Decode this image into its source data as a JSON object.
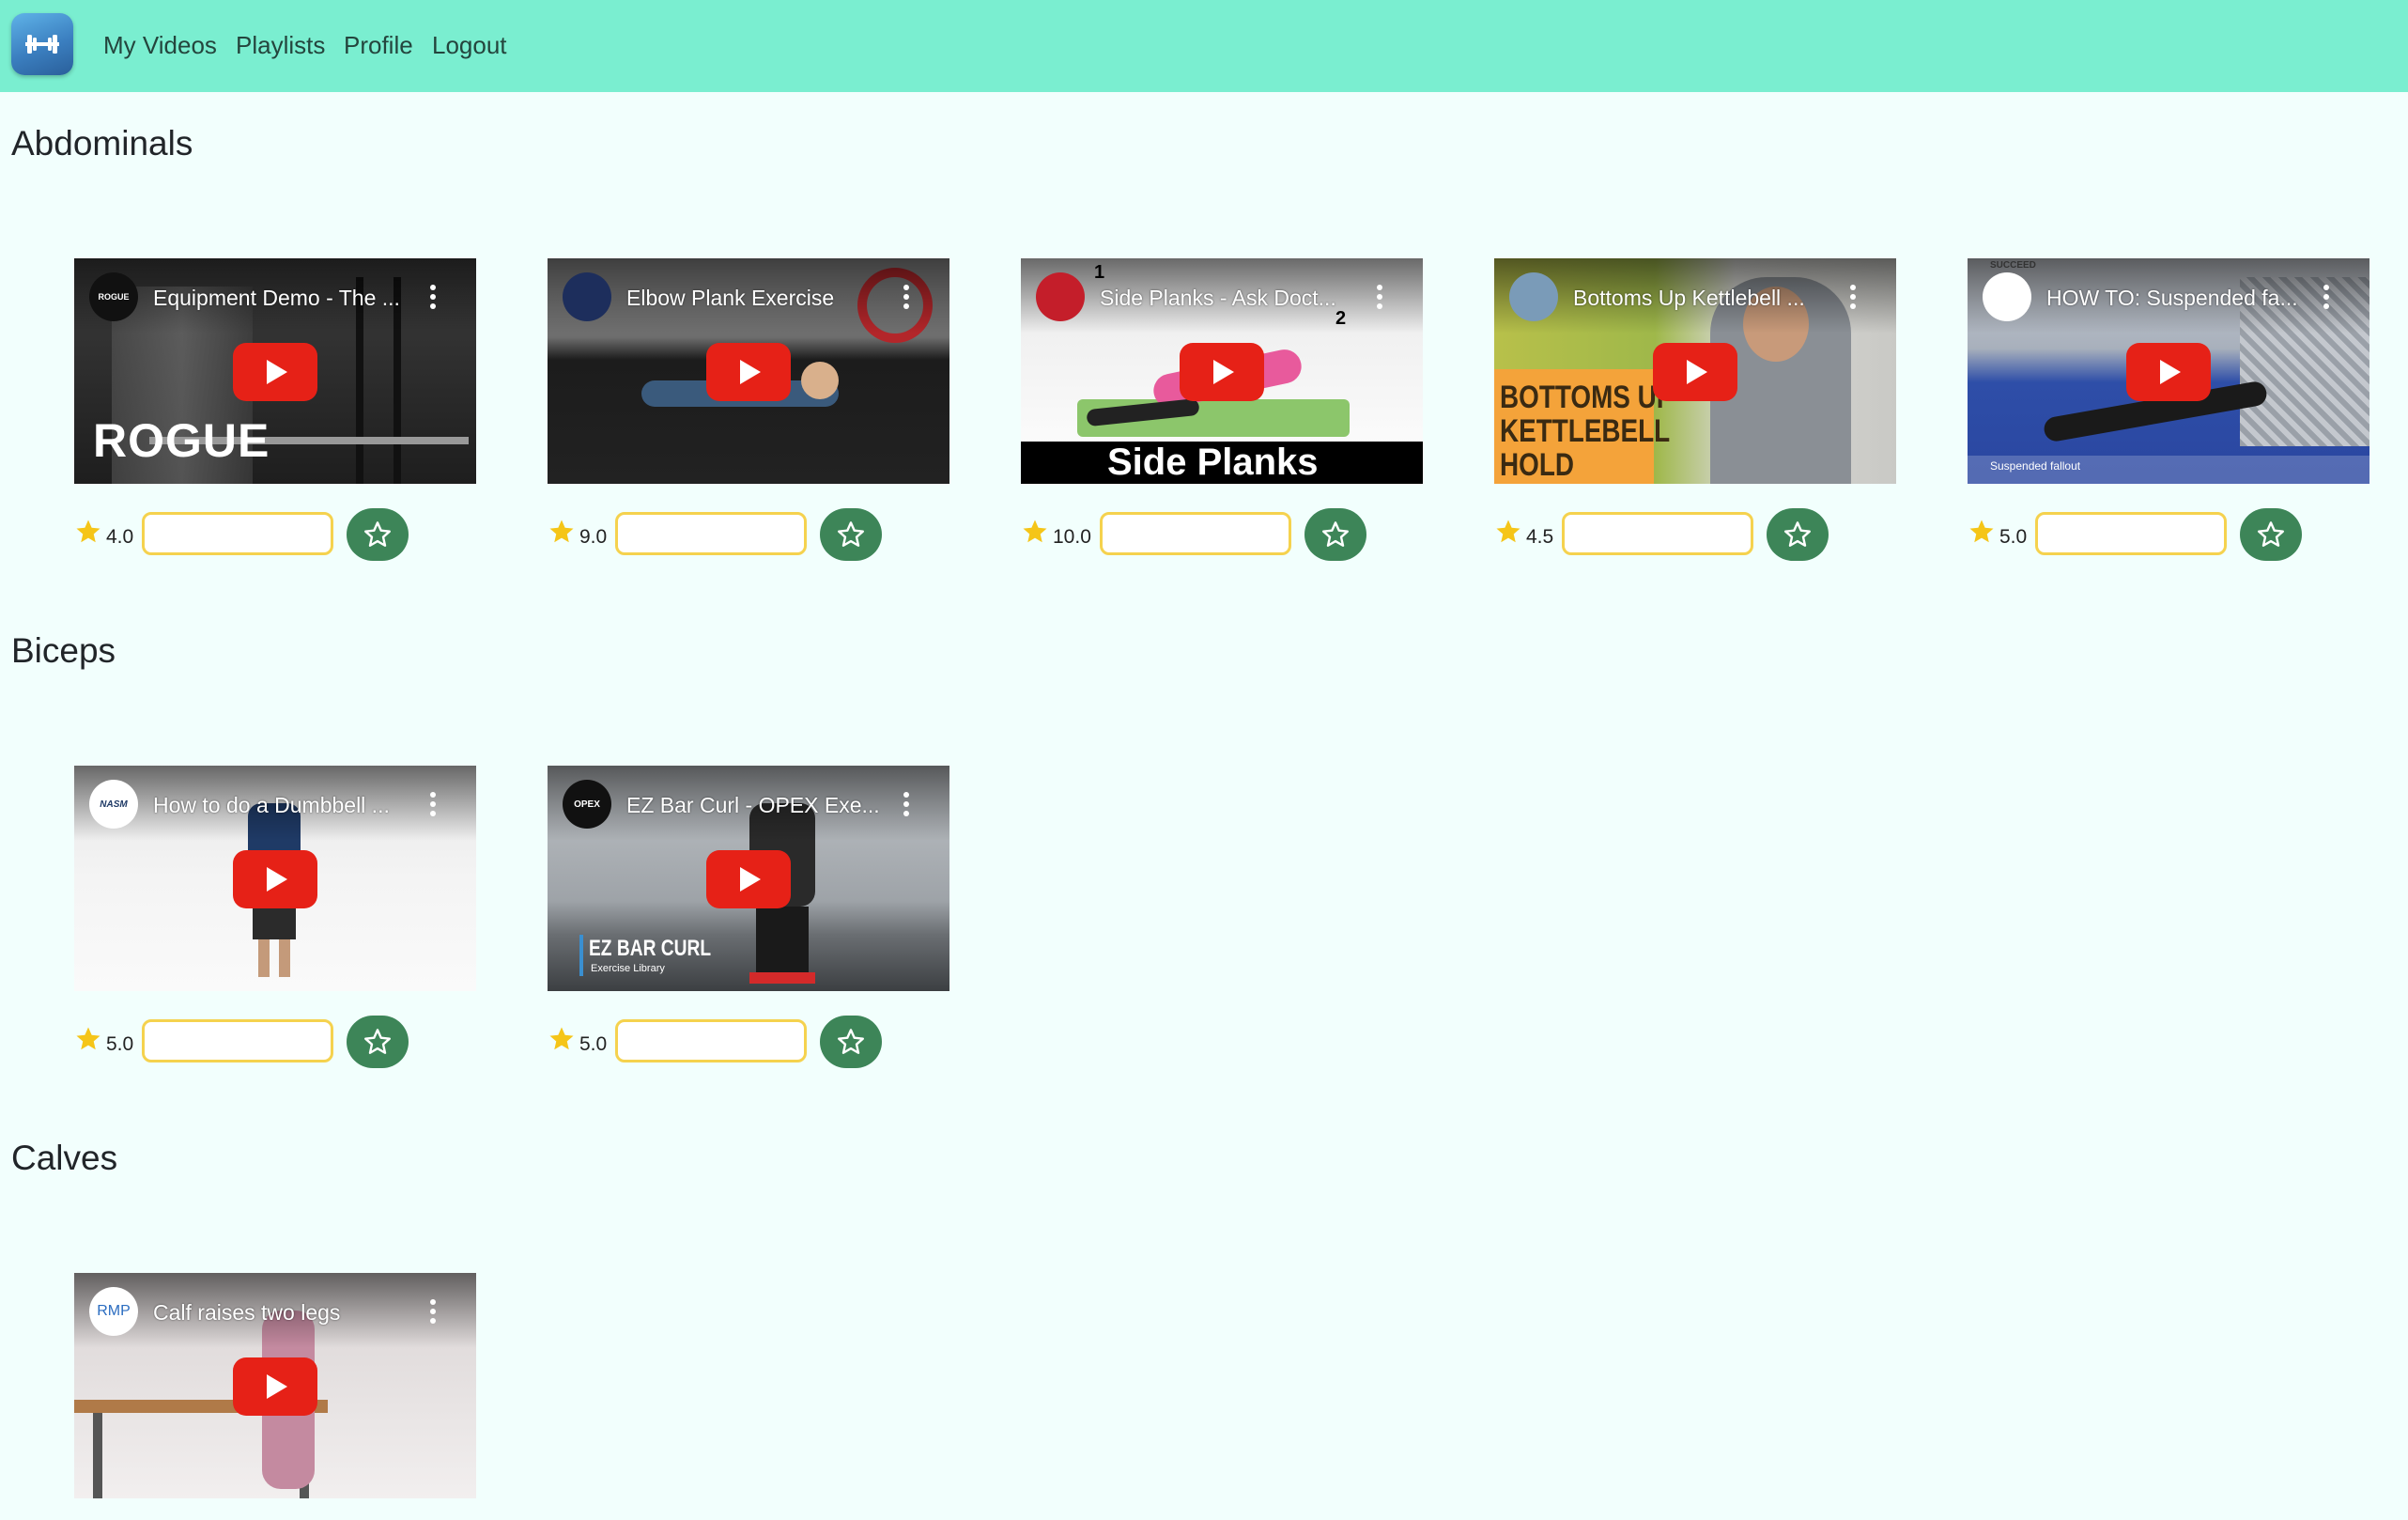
{
  "nav": {
    "logo_icon": "dumbbell-icon",
    "links": [
      "My Videos",
      "Playlists",
      "Profile",
      "Logout"
    ]
  },
  "sections": [
    {
      "title": "Abdominals",
      "videos": [
        {
          "title": "Equipment Demo - The ...",
          "channel": "ROGUE",
          "rating": "4.0",
          "overlay": "ROGUE"
        },
        {
          "title": "Elbow Plank Exercise",
          "channel": "",
          "rating": "9.0"
        },
        {
          "title": "Side Planks - Ask Doct...",
          "channel": "",
          "rating": "10.0",
          "overlay": "Side Planks",
          "marks": [
            "1",
            "2"
          ]
        },
        {
          "title": "Bottoms Up Kettlebell ...",
          "channel": "",
          "rating": "4.5",
          "overlay": [
            "BOTTOMS UP",
            "KETTLEBELL",
            "HOLD"
          ]
        },
        {
          "title": "HOW TO: Suspended fa...",
          "channel": "",
          "rating": "5.0",
          "brand": "SUCCEED",
          "caption": "Suspended fallout"
        }
      ]
    },
    {
      "title": "Biceps",
      "videos": [
        {
          "title": "How to do a Dumbbell ...",
          "channel": "NASM",
          "rating": "5.0"
        },
        {
          "title": "EZ Bar Curl - OPEX Exe...",
          "channel": "OPEX",
          "rating": "5.0",
          "overlay": [
            "EZ BAR CURL",
            "Exercise Library"
          ]
        }
      ]
    },
    {
      "title": "Calves",
      "videos": [
        {
          "title": "Calf raises two legs",
          "channel": "RMP",
          "rating": null
        }
      ]
    }
  ],
  "colors": {
    "navbar": "#7aeed0",
    "page_bg": "#f2fffd",
    "input_border": "#f5d24e",
    "favorite_button": "#3d8558",
    "star": "#f5c518",
    "play_button": "#e62117"
  },
  "icons": {
    "rating": "star-filled-icon",
    "favorite": "star-outline-icon",
    "play": "youtube-play-icon",
    "menu": "kebab-menu-icon"
  }
}
